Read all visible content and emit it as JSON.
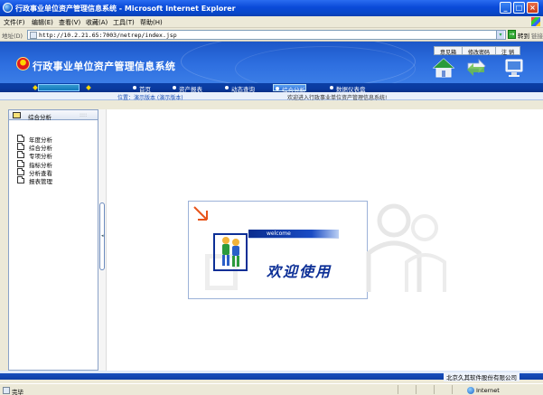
{
  "window": {
    "title": "行政事业单位资产管理信息系统 - Microsoft Internet Explorer",
    "min": "_",
    "max": "□",
    "close": "×"
  },
  "menu": [
    "文件(F)",
    "编辑(E)",
    "查看(V)",
    "收藏(A)",
    "工具(T)",
    "帮助(H)"
  ],
  "address": {
    "label": "地址(D)",
    "url": "http://10.2.21.65:7003/netrep/index.jsp",
    "go_label": "转到",
    "links_label": "链接"
  },
  "header": {
    "system_name": "行政事业单位资产管理信息系统",
    "top_links": [
      "意见箱",
      "修改密码",
      "注 销"
    ]
  },
  "nav": {
    "items": [
      {
        "label": "首页",
        "active": false
      },
      {
        "label": "资产报表",
        "active": false
      },
      {
        "label": "动态查询",
        "active": false
      },
      {
        "label": "综合分析",
        "active": true
      },
      {
        "label": "数据仪表盘",
        "active": false
      }
    ]
  },
  "location": {
    "path": "位置：演示版本 (演示版本)",
    "welcome": "欢迎进入行政事业单位资产管理信息系统!"
  },
  "sidebar": {
    "tab_label": "综合分析",
    "tab_extra": "::::",
    "items": [
      {
        "label": "年度分析"
      },
      {
        "label": "综合分析"
      },
      {
        "label": "专项分析"
      },
      {
        "label": "指标分析"
      },
      {
        "label": "分析查看"
      },
      {
        "label": "报表管理"
      }
    ]
  },
  "main": {
    "welcome_small": "welcome",
    "welcome_big": "欢迎使用"
  },
  "footer": {
    "company": "北京久其软件股份有限公司"
  },
  "status": {
    "text": "完毕",
    "zone": "Internet"
  }
}
